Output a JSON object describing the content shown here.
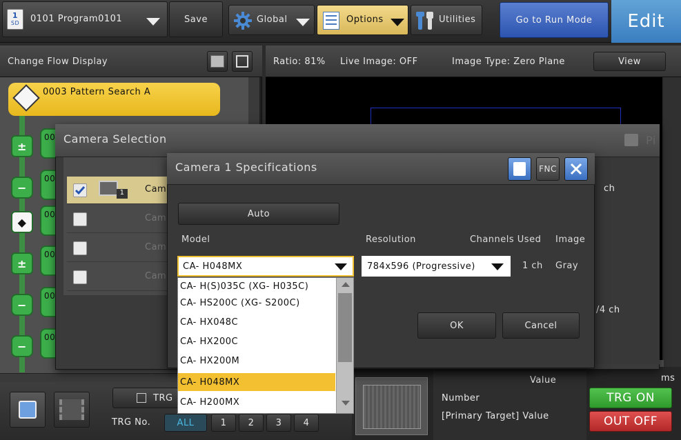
{
  "toolbar": {
    "program_label": "0101  Program0101",
    "save_label": "Save",
    "global_label": "Global",
    "options_label": "Options",
    "utilities_label": "Utilities",
    "run_mode_label": "Go to Run Mode",
    "edit_label": "Edit",
    "sd_badge": "SD",
    "sd_num": "1"
  },
  "left_panel": {
    "title": "Change Flow Display",
    "selected_item": "0003 Pattern Search A",
    "tab_prefix": "00"
  },
  "right_panel": {
    "ratio": "Ratio: 81%",
    "live_image": "Live Image: OFF",
    "image_type": "Image Type: Zero Plane",
    "view_label": "View"
  },
  "camera_selection": {
    "title": "Camera Selection",
    "rows": [
      {
        "label": "Cam",
        "checked": true,
        "badge": "1"
      },
      {
        "label": "Cam",
        "checked": false
      },
      {
        "label": "Cam",
        "checked": false
      },
      {
        "label": "Cam",
        "checked": false
      }
    ],
    "ch_label": "ch",
    "ch_total": "/4  ch",
    "side_label": "Pi"
  },
  "spec_dialog": {
    "title": "Camera  1  Specifications",
    "fnc_label": "FNC",
    "auto_label": "Auto",
    "model_label": "Model",
    "resolution_label": "Resolution",
    "channels_label": "Channels  Used",
    "image_label": "Image",
    "model_value": "CA- H048MX",
    "resolution_value": "784x596  (Progressive)",
    "channels_value": "1  ch",
    "image_value": "Gray",
    "ok_label": "OK",
    "cancel_label": "Cancel"
  },
  "model_dropdown": {
    "options": [
      "CA- H(S)035C  (XG- H035C)",
      "CA- HS200C  (XG- S200C)",
      "CA- HX048C",
      "CA- HX200C",
      "CA- HX200M",
      "CA- H048MX",
      "CA- H200MX"
    ],
    "selected_index": 5
  },
  "bottom": {
    "trg_label": "TRG",
    "trg_no_label": "TRG  No.",
    "trg_all": "ALL",
    "trg_numbers": [
      "1",
      "2",
      "3",
      "4"
    ],
    "value_header": "Value",
    "number_label": "Number",
    "primary_target_label": "[Primary  Target]  Value",
    "ms_label": "ms",
    "trg_on_label": "TRG ON",
    "out_off_label": "OUT OFF"
  },
  "colors": {
    "accent_yellow": "#f3c031",
    "run_blue": "#2d55b0",
    "edit_blue": "#3a7ec0",
    "flow_green": "#3cae4a",
    "trg_on_green": "#2f9a2c",
    "out_off_red": "#b22828"
  }
}
